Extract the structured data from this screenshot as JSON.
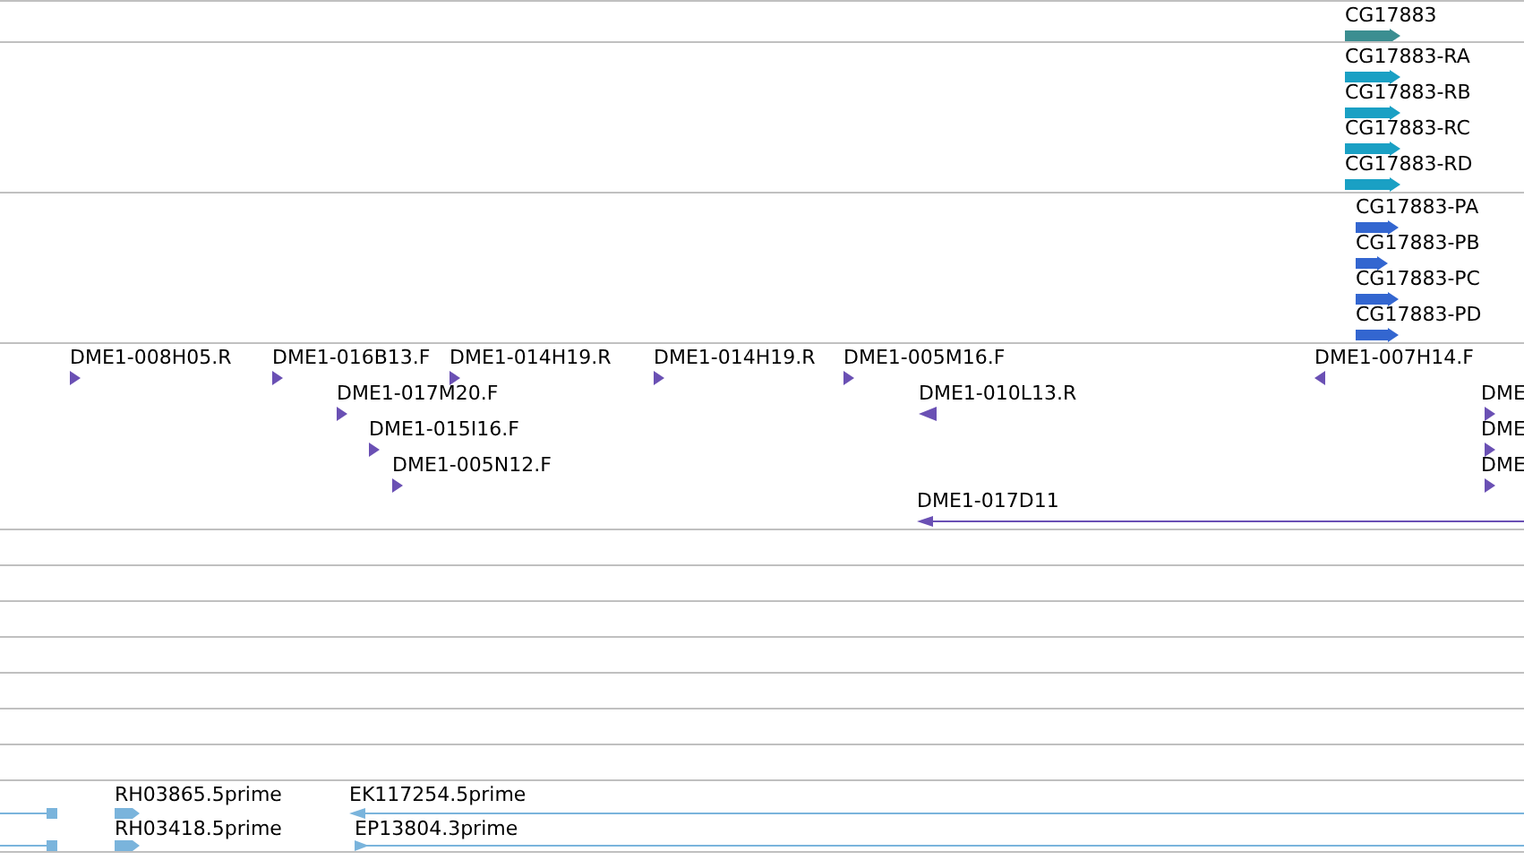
{
  "tracks": [
    {
      "kind": "gene",
      "features": [
        {
          "label": "CG17883",
          "kind": "forward"
        }
      ]
    },
    {
      "kind": "transcript",
      "features": [
        {
          "label": "CG17883-RA",
          "kind": "forward"
        },
        {
          "label": "CG17883-RB",
          "kind": "forward"
        },
        {
          "label": "CG17883-RC",
          "kind": "forward"
        },
        {
          "label": "CG17883-RD",
          "kind": "forward"
        }
      ]
    },
    {
      "kind": "protein",
      "features": [
        {
          "label": "CG17883-PA",
          "kind": "forward"
        },
        {
          "label": "CG17883-PB",
          "kind": "forward"
        },
        {
          "label": "CG17883-PC",
          "kind": "forward"
        },
        {
          "label": "CG17883-PD",
          "kind": "forward"
        }
      ]
    },
    {
      "kind": "clone",
      "features": [
        {
          "label": "DME1-008H05.R",
          "kind": "forward"
        },
        {
          "label": "DME1-016B13.F",
          "kind": "forward"
        },
        {
          "label": "DME1-014H19.R",
          "kind": "forward"
        },
        {
          "label": "DME1-014H19.R",
          "kind": "forward"
        },
        {
          "label": "DME1-005M16.F",
          "kind": "forward"
        },
        {
          "label": "DME1-007H14.F",
          "kind": "reverse"
        },
        {
          "label": "DME1-017M20.F",
          "kind": "forward"
        },
        {
          "label": "DME1-010L13.R",
          "kind": "reverse"
        },
        {
          "label": "DME1-015I16.F",
          "kind": "forward"
        },
        {
          "label": "DME1-005N12.F",
          "kind": "forward"
        },
        {
          "label": "DME",
          "kind": "forward"
        },
        {
          "label": "DME",
          "kind": "forward"
        },
        {
          "label": "DME",
          "kind": "forward"
        },
        {
          "label": "DME1-017D11",
          "kind": "reverse"
        }
      ]
    },
    {
      "kind": "empty"
    },
    {
      "kind": "empty"
    },
    {
      "kind": "empty"
    },
    {
      "kind": "empty"
    },
    {
      "kind": "empty"
    },
    {
      "kind": "empty"
    },
    {
      "kind": "empty"
    },
    {
      "kind": "est",
      "features": [
        {
          "kind": "reverse"
        },
        {
          "label": "RH03865.5prime",
          "kind": "forward"
        },
        {
          "label": "EK117254.5prime",
          "kind": "reverse"
        },
        {
          "kind": "reverse"
        },
        {
          "label": "RH03418.5prime",
          "kind": "forward"
        },
        {
          "label": "EP13804.3prime",
          "kind": "forward"
        }
      ]
    }
  ]
}
